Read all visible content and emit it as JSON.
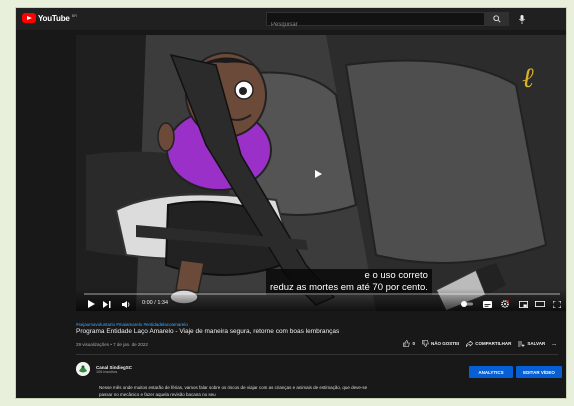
{
  "masthead": {
    "logo_text": "YouTube",
    "region": "BR",
    "search_placeholder": "Pesquisar"
  },
  "player": {
    "caption_line1": "e o uso correto",
    "caption_line2": "reduz as mortes em até 70 por cento.",
    "time_current": "0:00",
    "time_total": "1:34",
    "progress_fraction": 0.0
  },
  "video": {
    "hashtags": "#sejaumavoluntario #maiamarelo #entidadelacoamarelo",
    "title": "Programa Entidade Laço Amarelo - Viaje de maneira segura, retorne com boas lembranças",
    "meta": "29 visualizações • 7 de jan. de 2022"
  },
  "actions": {
    "like_count": "0",
    "dislike_label": "NÃO GOSTEI",
    "share_label": "COMPARTILHAR",
    "save_label": "SALVAR",
    "more_label": "..."
  },
  "channel": {
    "name": "Canal SindiegSC",
    "subscribers": "106 inscritos",
    "analytics_label": "ANALYTICS",
    "edit_label": "EDITAR VÍDEO"
  },
  "description": "Nesse mês onde muitos estarão de férias, vamos falar sobre os riscos de viajar com as crianças e animais de estimação, que deve-se passar no mecânico e fazer aquela revisão bacana no seu",
  "colors": {
    "accent": "#ff0000",
    "link": "#3ea6ff",
    "button": "#065fd4",
    "background": "#181818"
  }
}
